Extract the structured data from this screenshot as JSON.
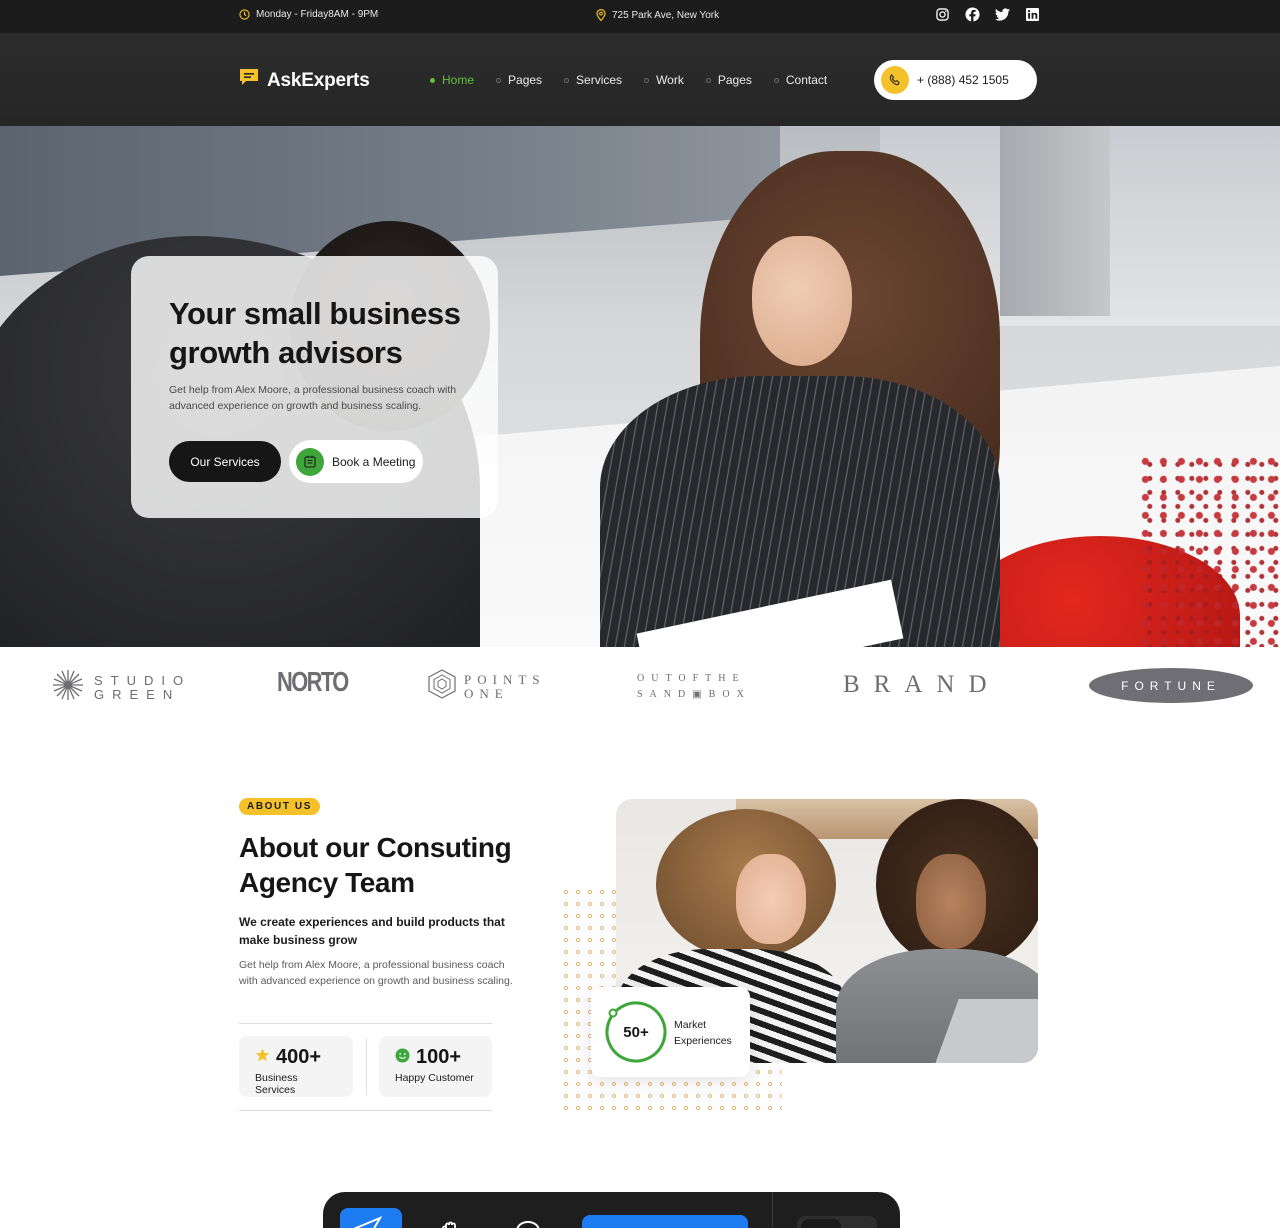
{
  "topbar": {
    "hours": "Monday - Friday8AM - 9PM",
    "address": "725 Park Ave, New York",
    "socials": [
      "instagram-icon",
      "facebook-icon",
      "twitter-icon",
      "linkedin-icon"
    ]
  },
  "header": {
    "logo_text": "AskExperts",
    "nav": [
      {
        "label": "Home",
        "active": true
      },
      {
        "label": "Pages",
        "active": false
      },
      {
        "label": "Services",
        "active": false
      },
      {
        "label": "Work",
        "active": false
      },
      {
        "label": "Pages",
        "active": false
      },
      {
        "label": "Contact",
        "active": false
      }
    ],
    "phone": "+ (888) 452 1505"
  },
  "hero": {
    "title": "Your small business growth advisors",
    "description": "Get help from Alex Moore, a professional business coach with advanced experience on growth and business scaling.",
    "primary_button": "Our Services",
    "secondary_button": "Book a Meeting"
  },
  "brands": {
    "studio_green": "STUDIO GREEN",
    "norto": "NORTO",
    "points_one": "POINTS ONE",
    "sandbox_line1": "OUTOFTHE",
    "sandbox_line2": "SAND▣BOX",
    "brand": "BRAND",
    "fortune": "FORTUNE"
  },
  "about": {
    "badge": "ABOUT US",
    "title": "About our Consuting Agency Team",
    "subtitle": "We create experiences and build products that make business grow",
    "description": "Get help from Alex Moore, a professional business coach with advanced experience on growth and business scaling.",
    "stats": [
      {
        "value": "400+",
        "label": "Business Services",
        "icon": "star-icon"
      },
      {
        "value": "100+",
        "label": "Happy Customer",
        "icon": "smile-icon"
      }
    ],
    "experience": {
      "value": "50+",
      "label": "Market Experiences"
    }
  },
  "colors": {
    "accent_yellow": "#f5c12b",
    "accent_green": "#5ec23a",
    "dark": "#161616",
    "dock_blue": "#1e7cf2"
  }
}
